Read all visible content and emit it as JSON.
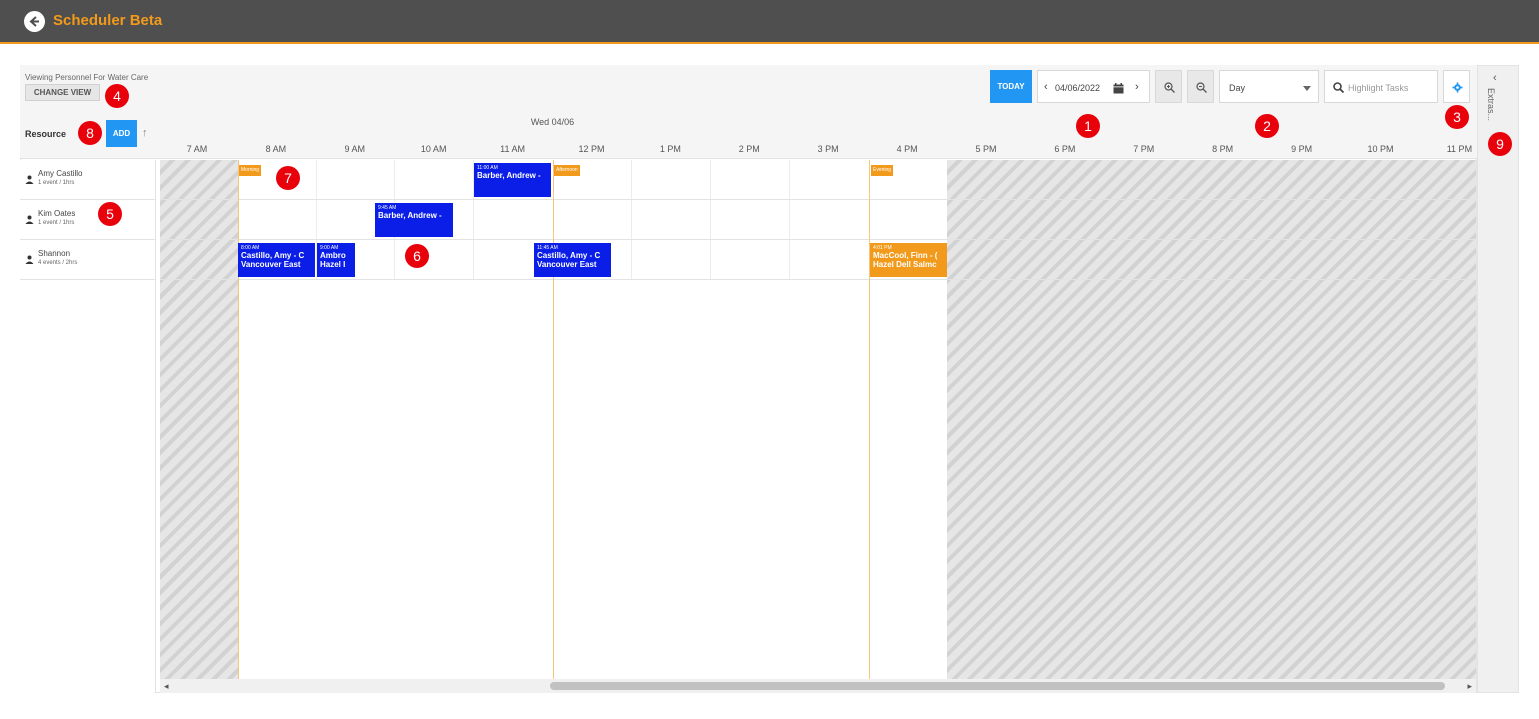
{
  "app": {
    "title": "Scheduler Beta"
  },
  "toolbar": {
    "viewing_text": "Viewing Personnel For Water Care",
    "change_view_label": "CHANGE VIEW",
    "today_label": "TODAY",
    "date_value": "04/06/2022",
    "view_mode": "Day",
    "highlight_placeholder": "Highlight Tasks"
  },
  "header": {
    "resource_label": "Resource",
    "add_label": "ADD",
    "date_label": "Wed 04/06",
    "hours": [
      "7 AM",
      "8 AM",
      "9 AM",
      "10 AM",
      "11 AM",
      "12 PM",
      "1 PM",
      "2 PM",
      "3 PM",
      "4 PM",
      "5 PM",
      "6 PM",
      "7 PM",
      "8 PM",
      "9 PM",
      "10 PM",
      "11 PM"
    ]
  },
  "resources": [
    {
      "name": "Amy Castillo",
      "summary": "1 event / 1hrs"
    },
    {
      "name": "Kim Oates",
      "summary": "1 event / 1hrs"
    },
    {
      "name": "Shannon",
      "summary": "4 events / 2hrs"
    }
  ],
  "shifts": [
    "Morning",
    "Afternoon",
    "Evening"
  ],
  "events": {
    "amy_1100": {
      "time": "11:00 AM",
      "line1": "Barber, Andrew -",
      "color": "#0a1ee8"
    },
    "kim_0945": {
      "time": "9:45 AM",
      "line1": "Barber, Andrew -",
      "color": "#0a1ee8"
    },
    "shannon_0800": {
      "time": "8:00 AM",
      "line1": "Castillo, Amy - C",
      "line2": "Vancouver East",
      "color": "#0a1ee8"
    },
    "shannon_0900": {
      "time": "9:00 AM",
      "line1": "Ambro",
      "line2": "Hazel I",
      "color": "#0a1ee8"
    },
    "shannon_1145": {
      "time": "11:45 AM",
      "line1": "Castillo, Amy - C",
      "line2": "Vancouver East",
      "color": "#0a1ee8"
    },
    "shannon_1601": {
      "time": "4:01 PM",
      "line1": "MacCool, Finn - (",
      "line2": "Hazel Dell Salmc",
      "color": "#f29a1c"
    }
  },
  "extras": {
    "label": "Extras..."
  },
  "markers": [
    "1",
    "2",
    "3",
    "4",
    "5",
    "6",
    "7",
    "8",
    "9"
  ],
  "colors": {
    "accent": "#f29a1c",
    "primary": "#2196f3",
    "event_blue": "#0a1ee8",
    "marker_red": "#e8000b"
  }
}
